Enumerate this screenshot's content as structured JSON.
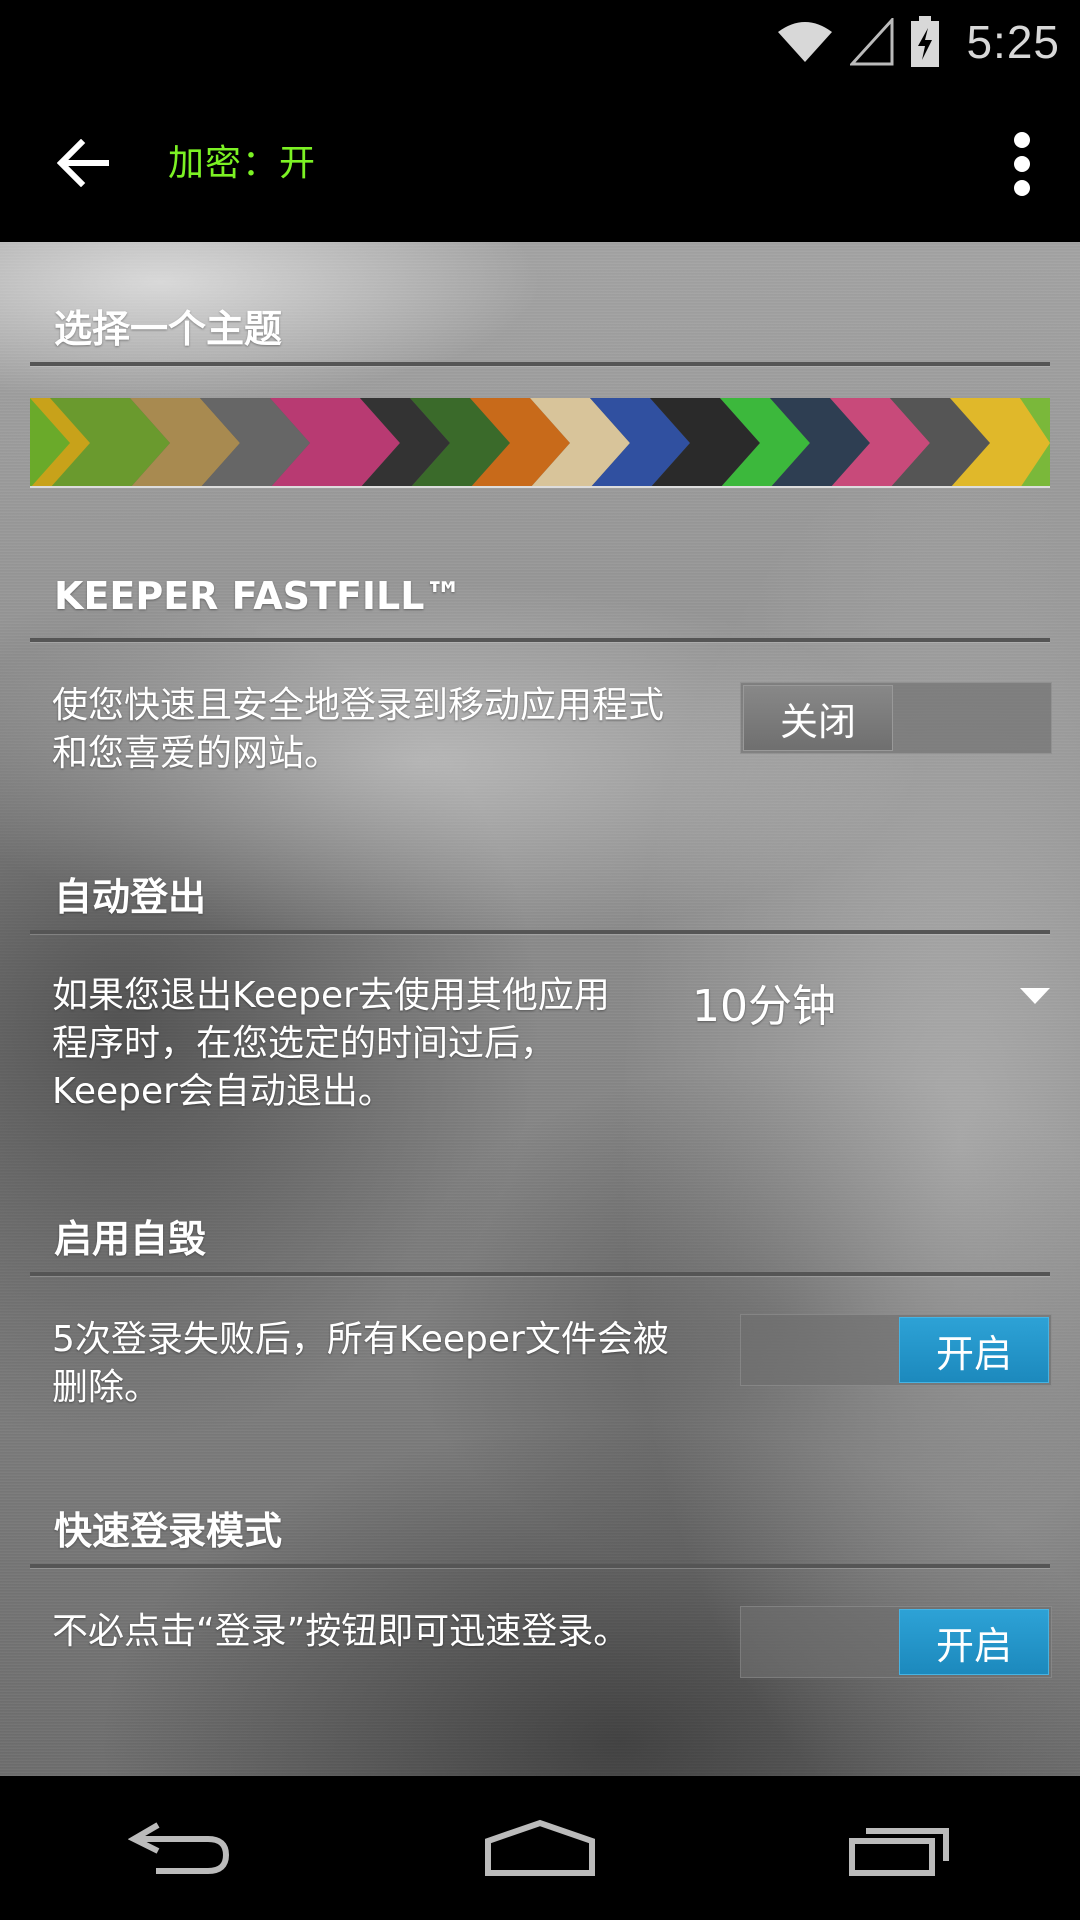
{
  "status_bar": {
    "time": "5:25",
    "icons": [
      "wifi-icon",
      "cell-signal-icon",
      "battery-charging-icon"
    ]
  },
  "app_bar": {
    "title": "加密：开",
    "title_color": "#7cf224",
    "back_icon": "arrow-left-icon",
    "menu_icon": "more-vert-icon"
  },
  "sections": {
    "theme": {
      "header": "选择一个主题"
    },
    "fastfill": {
      "header": "KEEPER FASTFILL™",
      "description": "使您快速且安全地登录到移动应用程式和您喜爱的网站。",
      "toggle_label": "关闭",
      "toggle_state": "off"
    },
    "auto_logout": {
      "header": "自动登出",
      "description": "如果您退出Keeper去使用其他应用程序时，在您选定的时间过后，Keeper会自动退出。",
      "selected_value": "10分钟"
    },
    "self_destruct": {
      "header": "启用自毁",
      "description": "5次登录失败后，所有Keeper文件会被删除。",
      "toggle_label": "开启",
      "toggle_state": "on"
    },
    "quick_login": {
      "header": "快速登录模式",
      "description": "不必点击“登录”按钮即可迅速登录。",
      "toggle_label": "开启",
      "toggle_state": "on"
    }
  },
  "colors": {
    "toggle_on": "#1c89bd",
    "toggle_off": "#777777"
  },
  "nav_bar": {
    "icons": [
      "nav-back-icon",
      "nav-home-icon",
      "nav-recents-icon"
    ]
  }
}
